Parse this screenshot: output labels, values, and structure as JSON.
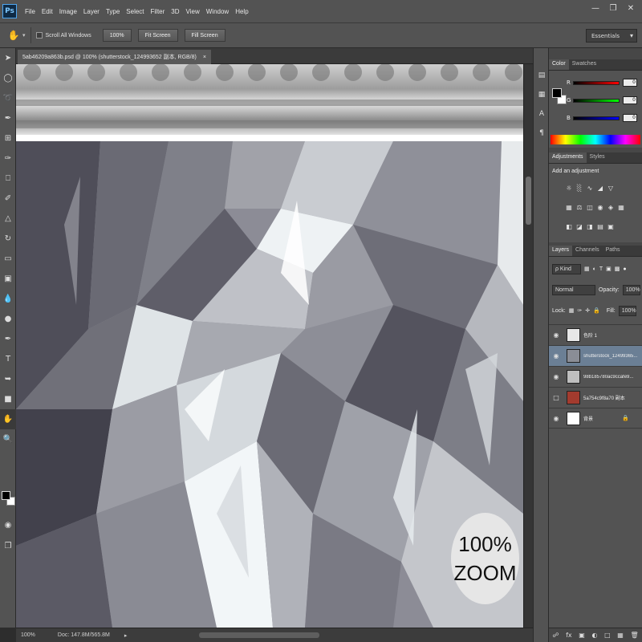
{
  "app": {
    "logo": "Ps",
    "menu": [
      "File",
      "Edit",
      "Image",
      "Layer",
      "Type",
      "Select",
      "Filter",
      "3D",
      "View",
      "Window",
      "Help"
    ],
    "window_controls": [
      "minimize-icon",
      "restore-icon",
      "close-icon"
    ]
  },
  "options_bar": {
    "scroll_all_windows": "Scroll All Windows",
    "btn_100": "100%",
    "btn_fit": "Fit Screen",
    "btn_fill": "Fill Screen",
    "workspace": "Essentials"
  },
  "document": {
    "tab_title": "5ab46209a863b.psd @ 100% (shutterstock_124993652 副本, RGB/8)",
    "zoom_badge_line1": "100%",
    "zoom_badge_line2": "ZOOM"
  },
  "status": {
    "zoom": "100%",
    "doc": "Doc: 147.8M/565.8M"
  },
  "color_panel": {
    "tabs": [
      "Color",
      "Swatches"
    ],
    "channels": [
      {
        "label": "R",
        "value": "0",
        "gradient": "linear-gradient(to right,#000000,#ff0000)"
      },
      {
        "label": "G",
        "value": "0",
        "gradient": "linear-gradient(to right,#000000,#00ff00)"
      },
      {
        "label": "B",
        "value": "0",
        "gradient": "linear-gradient(to right,#000000,#0000ff)"
      }
    ]
  },
  "adjustments_panel": {
    "tabs": [
      "Adjustments",
      "Styles"
    ],
    "title": "Add an adjustment"
  },
  "layers_panel": {
    "tabs": [
      "Layers",
      "Channels",
      "Paths"
    ],
    "kind": "ρ Kind",
    "blend_mode": "Normal",
    "opacity_label": "Opacity:",
    "opacity_value": "100%",
    "lock_label": "Lock:",
    "fill_label": "Fill:",
    "fill_value": "100%",
    "layers": [
      {
        "name": "色阶 1",
        "visible": true,
        "thumb": "#e8e8e8",
        "selected": false,
        "locked": false
      },
      {
        "name": "shutterstock_12499365...",
        "visible": true,
        "thumb": "#8a8d96",
        "selected": true,
        "locked": false
      },
      {
        "name": "98b185780ac9ccafe9...",
        "visible": true,
        "thumb": "#bfbfbf",
        "selected": false,
        "locked": false
      },
      {
        "name": "5a754c9f8a70 副本",
        "visible": false,
        "thumb": "#a33b2e",
        "selected": false,
        "locked": false
      },
      {
        "name": "背景",
        "visible": true,
        "thumb": "#ffffff",
        "selected": false,
        "locked": true
      }
    ]
  }
}
